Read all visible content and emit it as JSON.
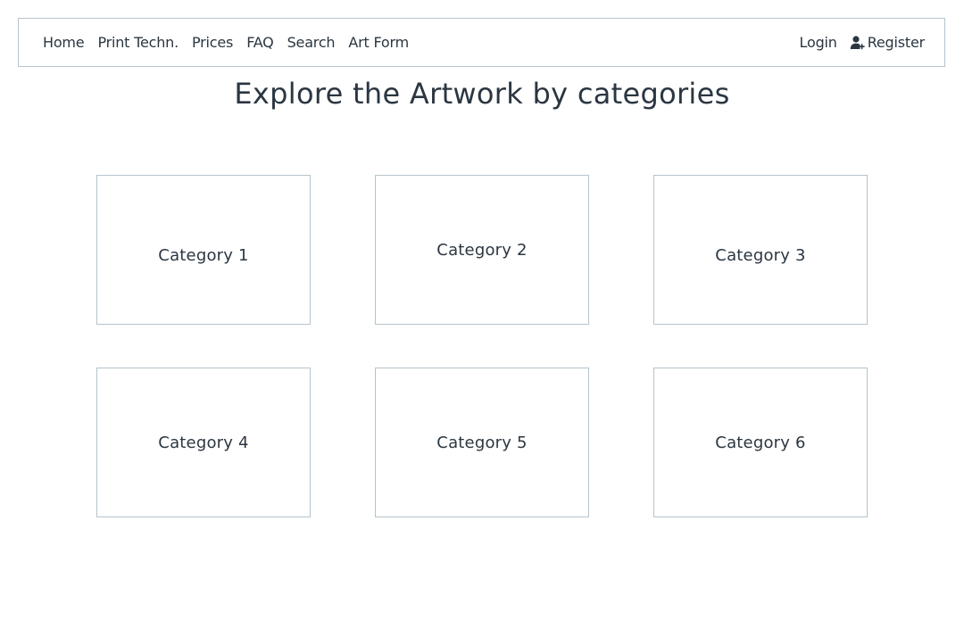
{
  "nav": {
    "left_items": [
      {
        "label": "Home"
      },
      {
        "label": "Print Techn."
      },
      {
        "label": "Prices"
      },
      {
        "label": "FAQ"
      },
      {
        "label": "Search"
      },
      {
        "label": "Art Form"
      }
    ],
    "login_label": "Login",
    "register_label": "Register",
    "register_icon": "user-plus-icon"
  },
  "main": {
    "title": "Explore the Artwork by categories",
    "categories": [
      {
        "label": "Category 1"
      },
      {
        "label": "Category 2"
      },
      {
        "label": "Category 3"
      },
      {
        "label": "Category 4"
      },
      {
        "label": "Category 5"
      },
      {
        "label": "Category 6"
      }
    ]
  },
  "colors": {
    "text": "#2b3641",
    "border": "#b4c4cc",
    "background": "#ffffff"
  }
}
